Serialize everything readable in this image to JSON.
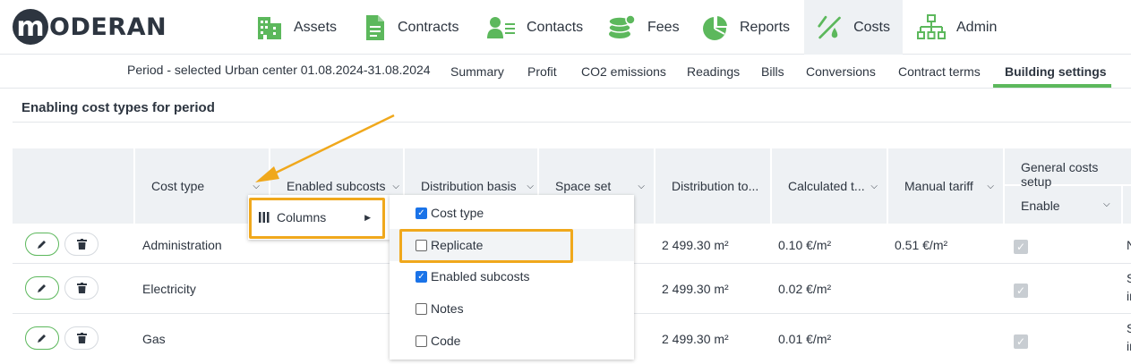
{
  "logo": {
    "mark": "m",
    "text": "ODERAN"
  },
  "nav": [
    {
      "label": "Assets",
      "icon": "building-icon"
    },
    {
      "label": "Contracts",
      "icon": "document-icon"
    },
    {
      "label": "Contacts",
      "icon": "contacts-icon"
    },
    {
      "label": "Fees",
      "icon": "coins-icon"
    },
    {
      "label": "Reports",
      "icon": "pie-chart-icon"
    },
    {
      "label": "Costs",
      "icon": "costs-icon",
      "active": true
    },
    {
      "label": "Admin",
      "icon": "org-chart-icon"
    }
  ],
  "period": "Period - selected Urban center 01.08.2024-31.08.2024",
  "subtabs": [
    "Summary",
    "Profit",
    "CO2 emissions",
    "Readings",
    "Bills",
    "Conversions",
    "Contract terms",
    "Building settings"
  ],
  "active_subtab": "Building settings",
  "section_title": "Enabling cost types for period",
  "columns": {
    "cost_type": "Cost type",
    "enabled_subcosts": "Enabled subcosts",
    "distribution_basis": "Distribution basis",
    "space_set": "Space set",
    "distribution_to": "Distribution to...",
    "calculated": "Calculated t...",
    "manual_tariff": "Manual tariff",
    "general_costs_setup": "General costs setup",
    "enable": "Enable"
  },
  "rows": [
    {
      "cost_type": "Administration",
      "distribution_to": "2 499.30 m²",
      "calculated": "0.10 €/m²",
      "manual_tariff": "0.51 €/m²",
      "trail_1": "N",
      "trail_2": ""
    },
    {
      "cost_type": "Electricity",
      "distribution_to": "2 499.30 m²",
      "calculated": "0.02 €/m²",
      "manual_tariff": "",
      "trail_1": "S",
      "trail_2": "ir"
    },
    {
      "cost_type": "Gas",
      "distribution_to": "2 499.30 m²",
      "calculated": "0.01 €/m²",
      "manual_tariff": "",
      "trail_1": "S",
      "trail_2": "ir"
    }
  ],
  "context_menu": {
    "columns_label": "Columns"
  },
  "column_options": [
    {
      "label": "Cost type",
      "checked": true
    },
    {
      "label": "Replicate",
      "checked": false
    },
    {
      "label": "Enabled subcosts",
      "checked": true
    },
    {
      "label": "Notes",
      "checked": false
    },
    {
      "label": "Code",
      "checked": false
    }
  ],
  "colors": {
    "accent_green": "#5cb85c",
    "highlight": "#f0a81c",
    "header_bg": "#eef1f4",
    "text": "#2d3540"
  }
}
